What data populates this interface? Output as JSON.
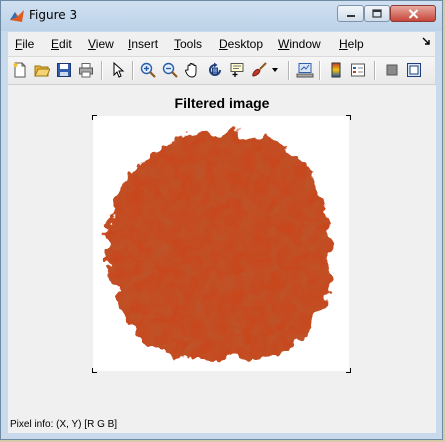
{
  "window": {
    "title": "Figure 3"
  },
  "menu": [
    {
      "name": "file",
      "label": "File"
    },
    {
      "name": "edit",
      "label": "Edit"
    },
    {
      "name": "view",
      "label": "View"
    },
    {
      "name": "insert",
      "label": "Insert"
    },
    {
      "name": "tools",
      "label": "Tools"
    },
    {
      "name": "desktop",
      "label": "Desktop"
    },
    {
      "name": "window",
      "label": "Window"
    },
    {
      "name": "help",
      "label": "Help"
    }
  ],
  "toolbar": {
    "icons": [
      "new-figure-icon",
      "open-file-icon",
      "save-icon",
      "print-icon",
      "edit-plot-icon",
      "zoom-in-icon",
      "zoom-out-icon",
      "pan-icon",
      "rotate-3d-icon",
      "data-cursor-icon",
      "brush-icon",
      "link-plot-icon",
      "colorbar-icon",
      "legend-icon",
      "hide-plot-tools-icon",
      "show-plot-tools-icon"
    ]
  },
  "figure": {
    "title": "Filtered image",
    "blob_color": "#c8461e"
  },
  "status": {
    "pixel_info": "Pixel info: (X, Y)  [R G B]"
  }
}
